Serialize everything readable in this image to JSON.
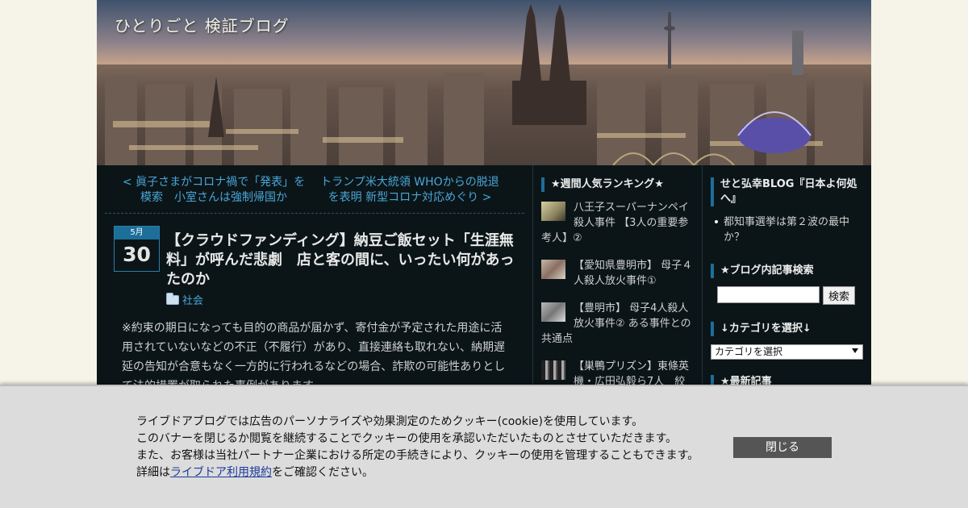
{
  "header": {
    "blog_title": "ひとりごと 検証ブログ"
  },
  "pager": {
    "prev": "< 眞子さまがコロナ禍で「発表」を模索　小室さんは強制帰国か",
    "next": "トランプ米大統領 WHOからの脱退を表明 新型コロナ対応めぐり >"
  },
  "post": {
    "month": "5月",
    "day": "30",
    "title": "【クラウドファンディング】納豆ご飯セット「生涯無料」が呼んだ悲劇　店と客の間に、いったい何があったのか",
    "category": "社会",
    "body": "※約束の期日になっても目的の商品が届かず、寄付金が予定された用途に活用されていないなどの不正（不履行）があり、直接連絡も取れない、納期遅延の告知が合意もなく一方的に行われるなどの場合、詐欺の可能性ありとして法的措置が取られた事例があります。"
  },
  "ranking": {
    "title": "★週間人気ランキング★",
    "items": [
      "八王子スーパーナンペイ殺人事件 【3人の重要参考人】②",
      "【愛知県豊明市】 母子４人殺人放火事件①",
      "【豊明市】 母子4人殺人放火事件② ある事件との共通点",
      "【巣鴨プリズン】東條英機・広田弘毅ら7人　絞"
    ]
  },
  "sidebar": {
    "news_title": "せと弘幸BLOG『日本よ何処へ』",
    "news_items": [
      "都知事選挙は第２波の最中か？"
    ],
    "search_title": "★ブログ内記事検索",
    "search_button": "検索",
    "category_title": "↓カテゴリを選択↓",
    "category_select": "カテゴリを選択",
    "latest_title": "★最新記事"
  },
  "cookie": {
    "line1": "ライブドアブログでは広告のパーソナライズや効果測定のためクッキー(cookie)を使用しています。",
    "line2": "このバナーを閉じるか閲覧を継続することでクッキーの使用を承認いただいたものとさせていただきます。",
    "line3": "また、お客様は当社パートナー企業における所定の手続きにより、クッキーの使用を管理することもできます。",
    "line4_prefix": "詳細は",
    "link": "ライブドア利用規約",
    "line4_suffix": "をご確認ください。",
    "close": "閉じる"
  }
}
